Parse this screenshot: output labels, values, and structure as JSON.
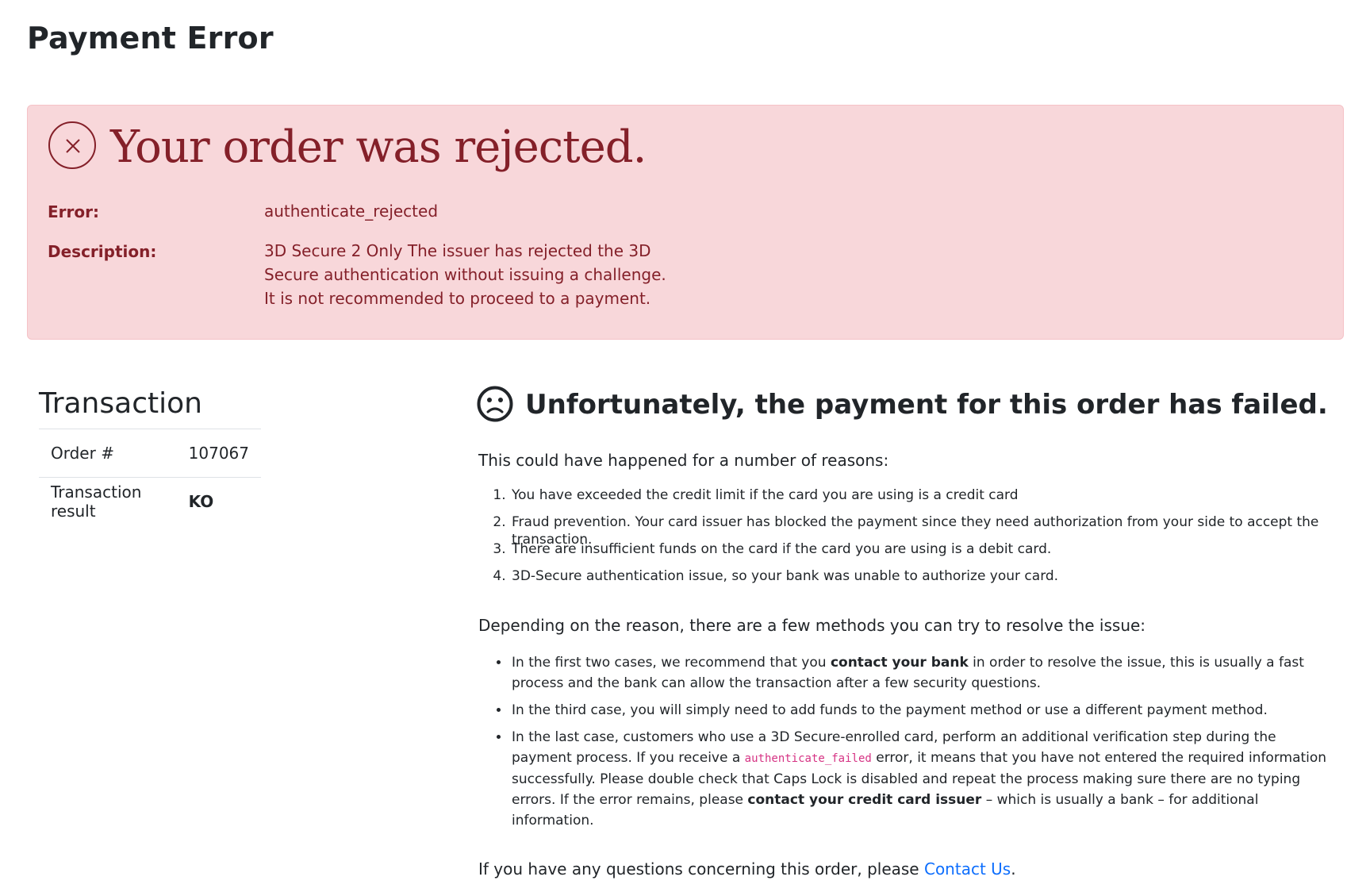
{
  "page": {
    "title": "Payment Error"
  },
  "alert": {
    "heading": "Your order was rejected.",
    "error_label": "Error:",
    "error_value": "authenticate_rejected",
    "description_label": "Description:",
    "description_value": "3D Secure 2 Only The issuer has rejected the 3D Secure authentication without issuing a challenge. It is not recommended to proceed to a payment.",
    "icon": "circle-x-icon",
    "colors": {
      "background": "#f8d7da",
      "border": "#f5c2c7",
      "text": "#842029"
    }
  },
  "transaction": {
    "heading": "Transaction",
    "rows": [
      {
        "label": "Order #",
        "value": "107067"
      },
      {
        "label": "Transaction result",
        "value": "KO"
      }
    ]
  },
  "failure": {
    "icon": "sad-face-icon",
    "heading": "Unfortunately, the payment for this order has failed.",
    "intro": "This could have happened for a number of reasons:",
    "reasons": [
      "You have exceeded the credit limit if the card you are using is a credit card",
      "Fraud prevention. Your card issuer has blocked the payment since they need authorization from your side to accept the transaction.",
      "There are insufficient funds on the card if the card you are using is a debit card.",
      "3D-Secure authentication issue, so your bank was unable to authorize your card."
    ],
    "resolve_intro": "Depending on the reason, there are a few methods you can try to resolve the issue:",
    "fix1": {
      "pre": "In the first two cases, we recommend that you ",
      "bold": "contact your bank",
      "post": " in order to resolve the issue, this is usually a fast process and the bank can allow the transaction after a few security questions."
    },
    "fix2": "In the third case, you will simply need to add funds to the payment method or use a different payment method.",
    "fix3": {
      "pre": "In the last case, customers who use a 3D Secure-enrolled card, perform an additional verification step during the payment process. If you receive a ",
      "code": "authenticate_failed",
      "mid": " error, it means that you have not entered the required information successfully. Please double check that Caps Lock is disabled and repeat the process making sure there are no typing errors. If the error remains, please ",
      "bold": "contact your credit card issuer",
      "post": " – which is usually a bank – for additional information."
    }
  },
  "contact": {
    "pre": "If you have any questions concerning this order, please ",
    "link": "Contact Us",
    "post": "."
  },
  "colors": {
    "link": "#0d6efd",
    "code": "#d63384"
  }
}
